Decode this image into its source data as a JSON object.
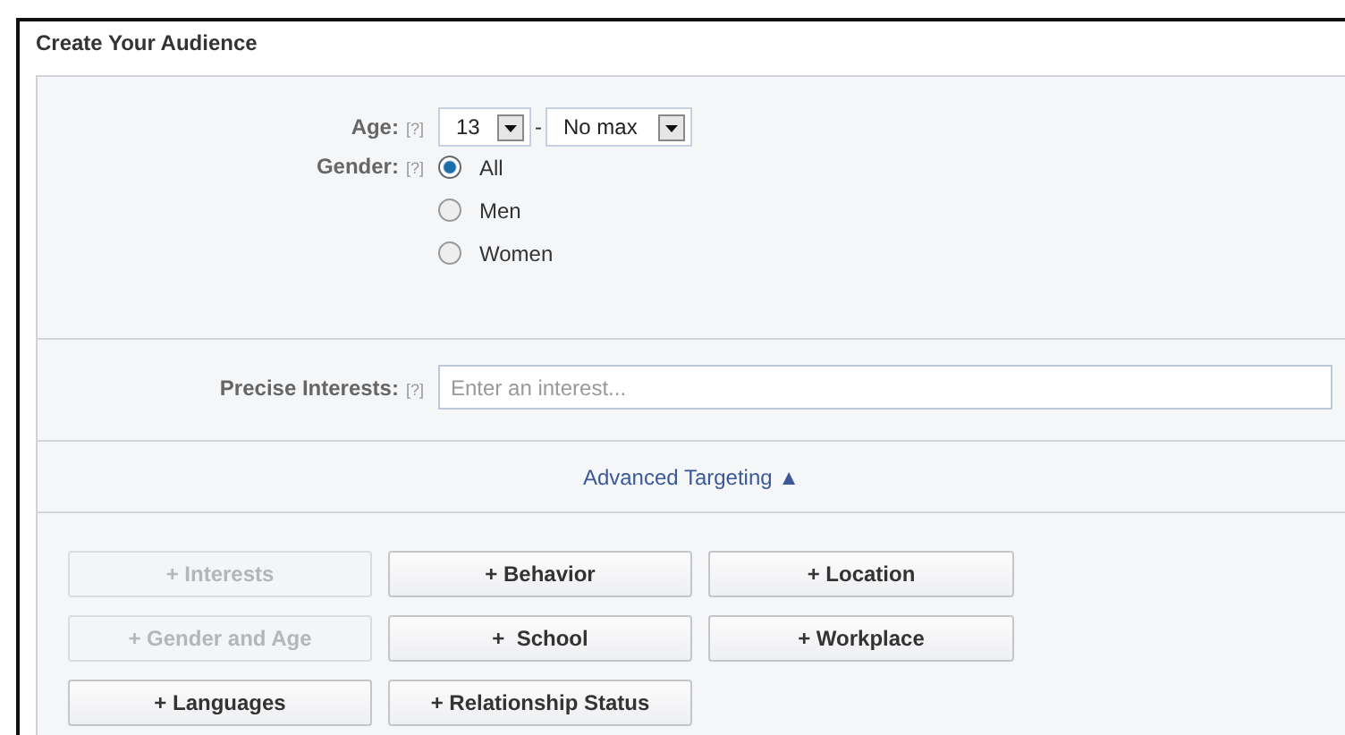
{
  "title": "Create Your Audience",
  "age": {
    "label": "Age:",
    "help": "[?]",
    "min": "13",
    "separator": "-",
    "max": "No max"
  },
  "gender": {
    "label": "Gender:",
    "help": "[?]",
    "options": [
      {
        "label": "All",
        "selected": true
      },
      {
        "label": "Men",
        "selected": false
      },
      {
        "label": "Women",
        "selected": false
      }
    ]
  },
  "interests": {
    "label": "Precise Interests:",
    "help": "[?]",
    "placeholder": "Enter an interest..."
  },
  "advanced": {
    "label": "Advanced Targeting",
    "arrow": "▲"
  },
  "buttons": [
    {
      "label": "+ Interests",
      "disabled": true
    },
    {
      "label": "+ Behavior",
      "disabled": false
    },
    {
      "label": "+ Location",
      "disabled": false
    },
    {
      "label": "+ Gender and Age",
      "disabled": true
    },
    {
      "label": "+  School",
      "disabled": false
    },
    {
      "label": "+ Workplace",
      "disabled": false
    },
    {
      "label": "+ Languages",
      "disabled": false
    },
    {
      "label": "+ Relationship Status",
      "disabled": false
    }
  ]
}
